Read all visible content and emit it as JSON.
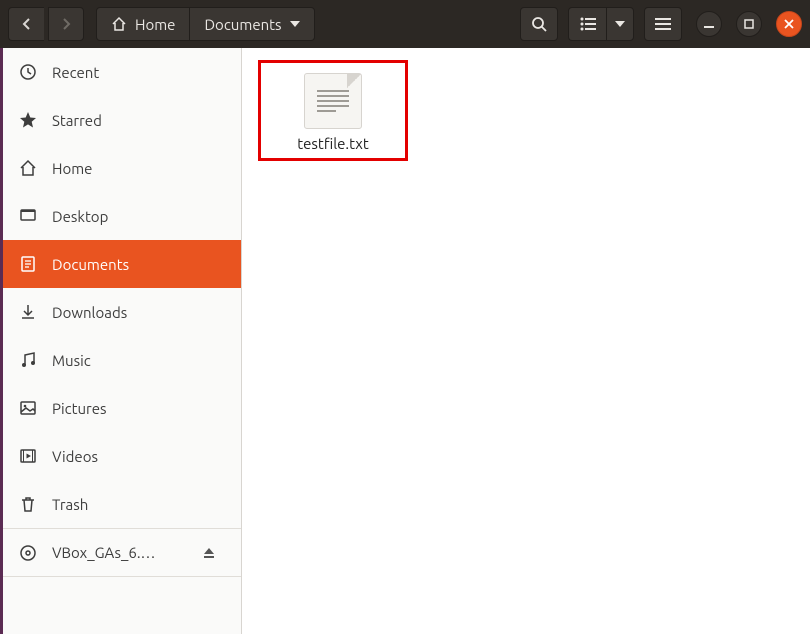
{
  "breadcrumb": {
    "home_label": "Home",
    "current_label": "Documents"
  },
  "sidebar": {
    "items": [
      {
        "id": "recent",
        "label": "Recent",
        "icon": "clock"
      },
      {
        "id": "starred",
        "label": "Starred",
        "icon": "star"
      },
      {
        "id": "home",
        "label": "Home",
        "icon": "home"
      },
      {
        "id": "desktop",
        "label": "Desktop",
        "icon": "desktop"
      },
      {
        "id": "documents",
        "label": "Documents",
        "icon": "doc",
        "active": true
      },
      {
        "id": "downloads",
        "label": "Downloads",
        "icon": "download"
      },
      {
        "id": "music",
        "label": "Music",
        "icon": "music"
      },
      {
        "id": "pictures",
        "label": "Pictures",
        "icon": "pictures"
      },
      {
        "id": "videos",
        "label": "Videos",
        "icon": "videos"
      },
      {
        "id": "trash",
        "label": "Trash",
        "icon": "trash"
      }
    ],
    "drive": {
      "label": "VBox_GAs_6.…",
      "icon": "disc"
    }
  },
  "files": [
    {
      "name": "testfile.txt",
      "type": "text",
      "highlight_color": "#e30000"
    }
  ]
}
